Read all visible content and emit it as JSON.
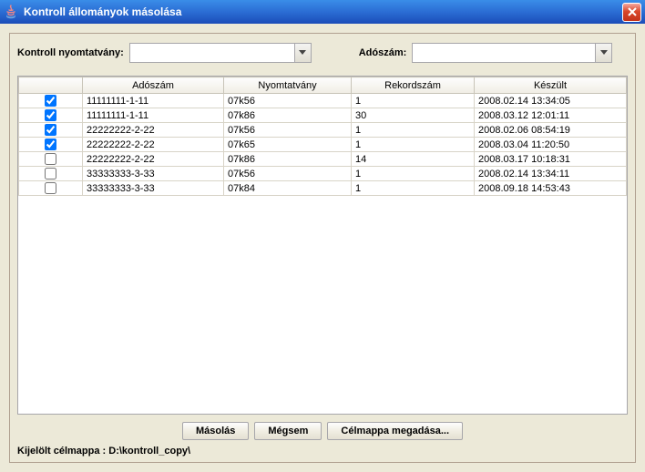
{
  "window": {
    "title": "Kontroll állományok másolása"
  },
  "filters": {
    "nyomtatvany_label": "Kontroll nyomtatvány:",
    "adoszam_label": "Adószám:",
    "nyomtatvany_value": "",
    "adoszam_value": ""
  },
  "table": {
    "headers": {
      "check": "",
      "adoszam": "Adószám",
      "nyomtatvany": "Nyomtatvány",
      "rekordszam": "Rekordszám",
      "keszult": "Készült"
    },
    "rows": [
      {
        "checked": true,
        "adoszam": "11111111-1-11",
        "nyomtatvany": "07k56",
        "rekordszam": "1",
        "keszult": "2008.02.14 13:34:05"
      },
      {
        "checked": true,
        "adoszam": "11111111-1-11",
        "nyomtatvany": "07k86",
        "rekordszam": "30",
        "keszult": "2008.03.12 12:01:11"
      },
      {
        "checked": true,
        "adoszam": "22222222-2-22",
        "nyomtatvany": "07k56",
        "rekordszam": "1",
        "keszult": "2008.02.06 08:54:19"
      },
      {
        "checked": true,
        "adoszam": "22222222-2-22",
        "nyomtatvany": "07k65",
        "rekordszam": "1",
        "keszult": "2008.03.04 11:20:50"
      },
      {
        "checked": false,
        "adoszam": "22222222-2-22",
        "nyomtatvany": "07k86",
        "rekordszam": "14",
        "keszult": "2008.03.17 10:18:31"
      },
      {
        "checked": false,
        "adoszam": "33333333-3-33",
        "nyomtatvany": "07k56",
        "rekordszam": "1",
        "keszult": "2008.02.14 13:34:11"
      },
      {
        "checked": false,
        "adoszam": "33333333-3-33",
        "nyomtatvany": "07k84",
        "rekordszam": "1",
        "keszult": "2008.09.18 14:53:43"
      }
    ]
  },
  "buttons": {
    "copy": "Másolás",
    "cancel": "Mégsem",
    "target": "Célmappa megadása..."
  },
  "footer": {
    "label": "Kijelölt célmappa : D:\\kontroll_copy\\"
  }
}
